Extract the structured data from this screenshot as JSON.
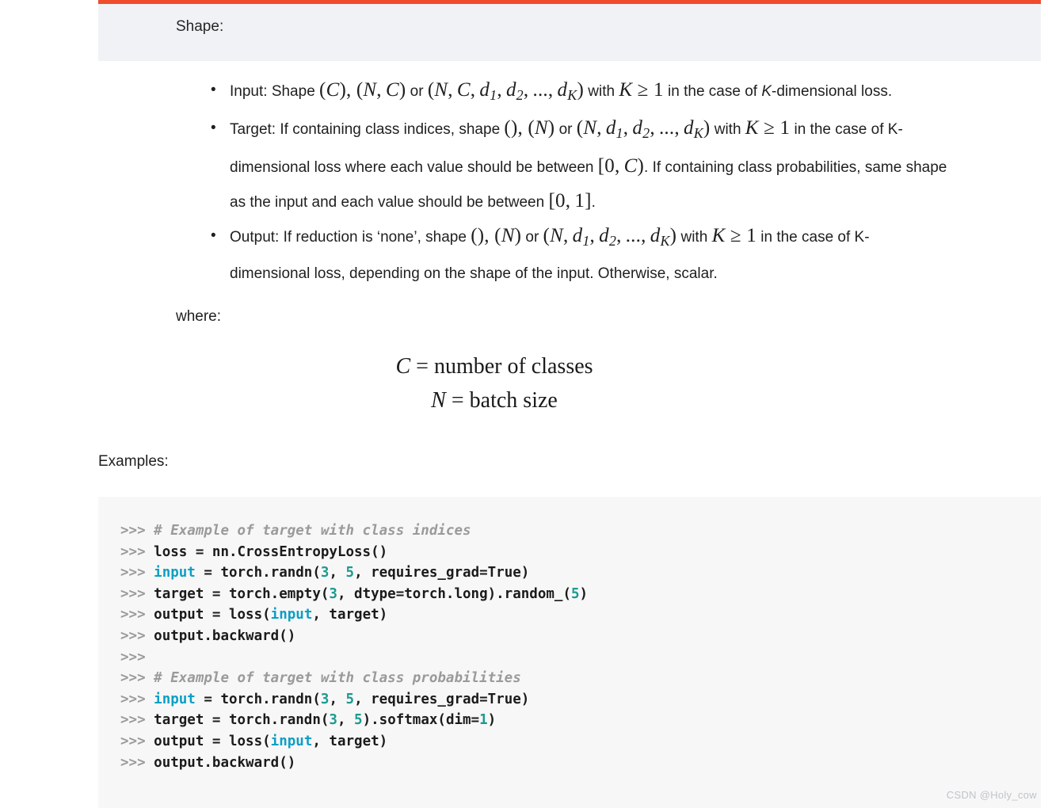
{
  "shape_section": {
    "title": "Shape:",
    "items": [
      {
        "id": "input",
        "label": "Input:",
        "text": "Input: Shape (C), (N, C) or (N, C, d₁, d₂, ..., d_K) with K ≥ 1 in the case of K-dimensional loss."
      },
      {
        "id": "target",
        "label": "Target:",
        "text": "Target: If containing class indices, shape (), (N) or (N, d₁, d₂, ..., d_K) with K ≥ 1 in the case of K-dimensional loss where each value should be between [0, C). If containing class probabilities, same shape as the input and each value should be between [0, 1]."
      },
      {
        "id": "output",
        "label": "Output:",
        "text": "Output: If reduction is ‘none’, shape (), (N) or (N, d₁, d₂, ..., d_K) with K ≥ 1 in the case of K-dimensional loss, depending on the shape of the input. Otherwise, scalar."
      }
    ],
    "fragments": {
      "input_pre": "Input: Shape ",
      "input_mid": " or ",
      "with": " with ",
      "k_ge_1": "K ≥ 1",
      "case_k_dim_full": " in the case of ",
      "k_dim_loss": "K",
      "dim_loss_suffix": "-dimensional loss.",
      "target_pre": "Target: If containing class indices, shape ",
      "target_or": " or ",
      "target_case_k": " in the case of K-",
      "target_l2a": "dimensional loss where each value should be between ",
      "target_l2b": ". If containing class probabilities, same shape",
      "target_l3a": "as the input and each value should be between ",
      "target_l3b": ".",
      "output_pre": "Output: If reduction is ‘none’, shape ",
      "output_or": " or ",
      "output_case_k": " in the case of K-",
      "output_l2": "dimensional loss, depending on the shape of the input. Otherwise, scalar."
    },
    "math": {
      "c_paren": "(C)",
      "nc_paren": "(N, C)",
      "ncd_paren": "(N, C, d1, d2, ..., dK)",
      "empty_paren": "()",
      "n_paren": "(N)",
      "nd_paren": "(N, d1, d2, ..., dK)",
      "interval_0c": "[0, C)",
      "interval_01": "[0, 1]"
    }
  },
  "where_label": "where:",
  "equations": [
    {
      "lhs": "C",
      "rel": "=",
      "rhs": "number of classes"
    },
    {
      "lhs": "N",
      "rel": "=",
      "rhs": "batch size"
    }
  ],
  "examples_label": "Examples:",
  "code": {
    "lines": [
      {
        "prompt": ">>> ",
        "tokens": [
          {
            "t": "# Example of target with class indices",
            "c": "comment"
          }
        ]
      },
      {
        "prompt": ">>> ",
        "tokens": [
          {
            "t": "loss = nn.CrossEntropyLoss()",
            "c": "plain"
          }
        ]
      },
      {
        "prompt": ">>> ",
        "tokens": [
          {
            "t": "input",
            "c": "builtin"
          },
          {
            "t": " = torch.randn(",
            "c": "plain"
          },
          {
            "t": "3",
            "c": "num"
          },
          {
            "t": ", ",
            "c": "plain"
          },
          {
            "t": "5",
            "c": "num"
          },
          {
            "t": ", requires_grad=True)",
            "c": "plain"
          }
        ]
      },
      {
        "prompt": ">>> ",
        "tokens": [
          {
            "t": "target = torch.empty(",
            "c": "plain"
          },
          {
            "t": "3",
            "c": "num"
          },
          {
            "t": ", dtype=torch.long).random_(",
            "c": "plain"
          },
          {
            "t": "5",
            "c": "num"
          },
          {
            "t": ")",
            "c": "plain"
          }
        ]
      },
      {
        "prompt": ">>> ",
        "tokens": [
          {
            "t": "output = loss(",
            "c": "plain"
          },
          {
            "t": "input",
            "c": "builtin"
          },
          {
            "t": ", target)",
            "c": "plain"
          }
        ]
      },
      {
        "prompt": ">>> ",
        "tokens": [
          {
            "t": "output.backward()",
            "c": "plain"
          }
        ]
      },
      {
        "prompt": ">>>",
        "tokens": []
      },
      {
        "prompt": ">>> ",
        "tokens": [
          {
            "t": "# Example of target with class probabilities",
            "c": "comment"
          }
        ]
      },
      {
        "prompt": ">>> ",
        "tokens": [
          {
            "t": "input",
            "c": "builtin"
          },
          {
            "t": " = torch.randn(",
            "c": "plain"
          },
          {
            "t": "3",
            "c": "num"
          },
          {
            "t": ", ",
            "c": "plain"
          },
          {
            "t": "5",
            "c": "num"
          },
          {
            "t": ", requires_grad=True)",
            "c": "plain"
          }
        ]
      },
      {
        "prompt": ">>> ",
        "tokens": [
          {
            "t": "target = torch.randn(",
            "c": "plain"
          },
          {
            "t": "3",
            "c": "num"
          },
          {
            "t": ", ",
            "c": "plain"
          },
          {
            "t": "5",
            "c": "num"
          },
          {
            "t": ").softmax(dim=",
            "c": "plain"
          },
          {
            "t": "1",
            "c": "num"
          },
          {
            "t": ")",
            "c": "plain"
          }
        ]
      },
      {
        "prompt": ">>> ",
        "tokens": [
          {
            "t": "output = loss(",
            "c": "plain"
          },
          {
            "t": "input",
            "c": "builtin"
          },
          {
            "t": ", target)",
            "c": "plain"
          }
        ]
      },
      {
        "prompt": ">>> ",
        "tokens": [
          {
            "t": "output.backward()",
            "c": "plain"
          }
        ]
      }
    ]
  },
  "watermark": "CSDN @Holy_cow",
  "colors": {
    "accent_bar": "#ee4c2c",
    "admonition_bg": "#f0f2f5",
    "code_bg": "#f7f7f7",
    "code_builtin": "#0b9fc4",
    "code_number": "#1a9b8f",
    "code_comment": "#9a9a9a",
    "watermark": "#c0c4c9"
  }
}
